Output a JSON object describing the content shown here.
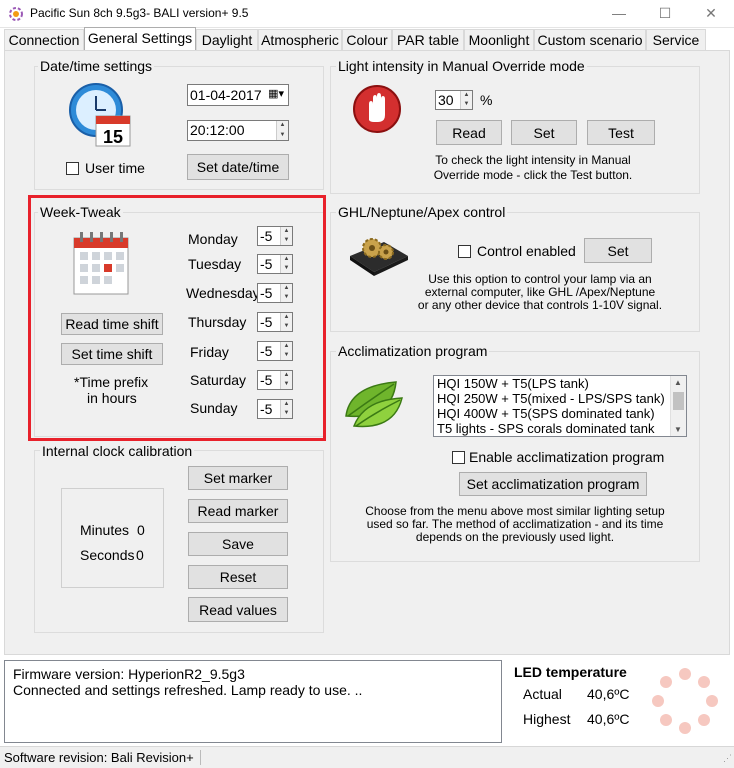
{
  "window": {
    "title": "Pacific Sun 8ch 9.5g3- BALI version+ 9.5",
    "minimize": "—",
    "maximize": "☐",
    "close": "✕"
  },
  "tabs": [
    {
      "label": "Connection"
    },
    {
      "label": "General Settings"
    },
    {
      "label": "Daylight"
    },
    {
      "label": "Atmospheric"
    },
    {
      "label": "Colour"
    },
    {
      "label": "PAR table"
    },
    {
      "label": "Moonlight"
    },
    {
      "label": "Custom scenario"
    },
    {
      "label": "Service"
    }
  ],
  "datetime": {
    "title": "Date/time settings",
    "calendar_day": "15",
    "date_value": "01-04-2017",
    "time_value": "20:12:00",
    "user_time_label": "User time",
    "set_button": "Set date/time"
  },
  "week_tweak": {
    "title": "Week-Tweak",
    "days": [
      {
        "label": "Monday",
        "value": "-5"
      },
      {
        "label": "Tuesday",
        "value": "-5"
      },
      {
        "label": "Wednesday",
        "value": "-5"
      },
      {
        "label": "Thursday",
        "value": "-5"
      },
      {
        "label": "Friday",
        "value": "-5"
      },
      {
        "label": "Saturday",
        "value": "-5"
      },
      {
        "label": "Sunday",
        "value": "-5"
      }
    ],
    "read_button": "Read time shift",
    "set_button": "Set time shift",
    "note_line1": "*Time prefix",
    "note_line2": "in hours"
  },
  "clock_cal": {
    "title": "Internal clock calibration",
    "minutes_label": "Minutes",
    "minutes_value": "0",
    "seconds_label": "Seconds",
    "seconds_value": "0",
    "buttons": {
      "set_marker": "Set marker",
      "read_marker": "Read marker",
      "save": "Save",
      "reset": "Reset",
      "read_values": "Read values"
    }
  },
  "light_intensity": {
    "title": "Light intensity in Manual Override mode",
    "value": "30",
    "unit": "%",
    "read_button": "Read",
    "set_button": "Set",
    "test_button": "Test",
    "note_line1": "To check the light intensity in Manual",
    "note_line2": "Override mode - click the Test button."
  },
  "ghl": {
    "title": "GHL/Neptune/Apex control",
    "control_label": "Control enabled",
    "set_button": "Set",
    "note_line1": "Use this option to control your lamp via an",
    "note_line2": "external computer, like GHL /Apex/Neptune",
    "note_line3": "or any other device that controls 1-10V signal."
  },
  "acclimatization": {
    "title": "Acclimatization program",
    "options": [
      "HQI 150W + T5(LPS tank)",
      "HQI 250W + T5(mixed - LPS/SPS tank)",
      "HQI 400W + T5(SPS dominated tank)",
      "T5 lights - SPS corals dominated tank"
    ],
    "enable_label": "Enable acclimatization program",
    "set_button": "Set acclimatization program",
    "note_line1": "Choose from the menu above most similar lighting setup",
    "note_line2": "used so far. The method of acclimatization - and its time",
    "note_line3": "depends on the previously used light."
  },
  "status": {
    "line1": "Firmware version: HyperionR2_9.5g3",
    "line2": "Connected and settings refreshed. Lamp ready to use. .."
  },
  "led_temp": {
    "title": "LED temperature",
    "actual_label": "Actual",
    "actual_value": "40,6ºC",
    "highest_label": "Highest",
    "highest_value": "40,6ºC"
  },
  "statusbar": {
    "text": "Software revision: Bali Revision+"
  },
  "colors": {
    "highlight": "#e8212b",
    "pane": "#f0f0f0"
  }
}
